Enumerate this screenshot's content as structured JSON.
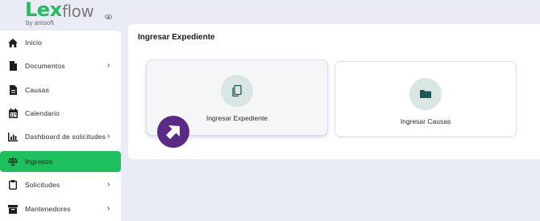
{
  "brand": {
    "name_primary": "Lex",
    "name_secondary": "flow",
    "byline": "by amsoft",
    "color": "#1fbf5f"
  },
  "sidebar": {
    "items": [
      {
        "label": "Inicio",
        "icon": "home-icon",
        "has_submenu": false,
        "active": false
      },
      {
        "label": "Documentos",
        "icon": "document-icon",
        "has_submenu": true,
        "active": false
      },
      {
        "label": "Causas",
        "icon": "file-text-icon",
        "has_submenu": false,
        "active": false
      },
      {
        "label": "Calendario",
        "icon": "calendar-icon",
        "has_submenu": false,
        "active": false
      },
      {
        "label": "Dashboard de solicitudes",
        "icon": "bar-chart-icon",
        "has_submenu": true,
        "active": false
      },
      {
        "label": "Ingresos",
        "icon": "scales-icon",
        "has_submenu": false,
        "active": true
      },
      {
        "label": "Solicitudes",
        "icon": "clipboard-icon",
        "has_submenu": true,
        "active": false
      },
      {
        "label": "Mantenedores",
        "icon": "archive-box-icon",
        "has_submenu": true,
        "active": false
      }
    ],
    "active_color": "#1ebf5d",
    "submenu_chevron": "›"
  },
  "main": {
    "title": "Ingresar Expediente",
    "cards": [
      {
        "label": "Ingresar Expediente",
        "icon": "copy-documents-icon"
      },
      {
        "label": "Ingresar Causas",
        "icon": "folder-icon"
      }
    ],
    "icon_color": "#1d5a55",
    "circle_color": "#d9e6e3"
  },
  "overlay": {
    "badge_icon": "arrow-up-left-icon",
    "badge_color": "#5b2a86"
  }
}
